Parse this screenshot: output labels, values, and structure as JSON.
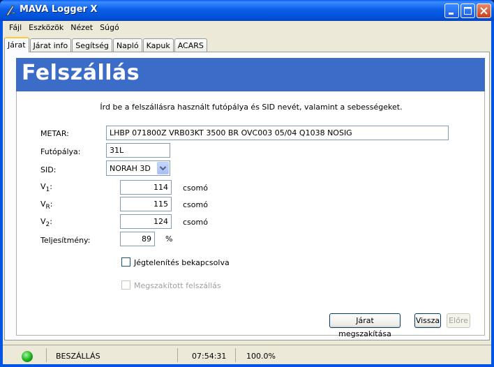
{
  "window": {
    "title": "MAVA Logger X"
  },
  "menu": [
    "Fájl",
    "Eszközök",
    "Nézet",
    "Súgó"
  ],
  "tabs": [
    "Járat",
    "Járat info",
    "Segítség",
    "Napló",
    "Kapuk",
    "ACARS"
  ],
  "page": {
    "title": "Felszállás",
    "instruction": "Írd be a felszállásra használt futópálya és SID nevét, valamint a sebességeket."
  },
  "form": {
    "metar_label": "METAR:",
    "metar_value": "LHBP 071800Z VRB03KT 3500 BR OVC003 05/04 Q1038 NOSIG",
    "runway_label": "Futópálya:",
    "runway_value": "31L",
    "sid_label": "SID:",
    "sid_value": "NORAH 3D",
    "v1_main": "V",
    "v1_sub": "1",
    "v1_value": "114",
    "vr_main": "V",
    "vr_sub": "R",
    "vr_value": "115",
    "v2_main": "V",
    "v2_sub": "2",
    "v2_value": "124",
    "colon": ":",
    "unit_speed": "csomó",
    "power_label": "Teljesítmény:",
    "power_value": "89",
    "power_unit": "%",
    "anti_ice_label": "Jégtelenítés bekapcsolva",
    "rejected_label": "Megszakított felszállás"
  },
  "buttons": {
    "abort": "Járat megszakítása",
    "back": "Vissza",
    "next": "Előre"
  },
  "status": {
    "state": "BESZÁLLÁS",
    "time": "07:54:31",
    "percent": "100.0%"
  }
}
